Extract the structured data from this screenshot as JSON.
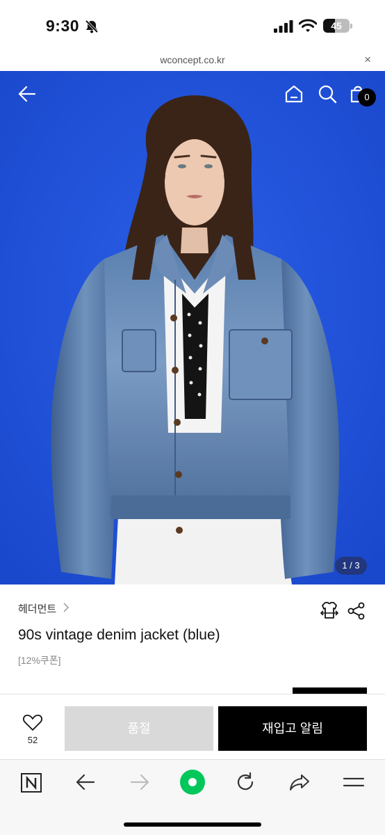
{
  "status_bar": {
    "time": "9:30",
    "battery_level": "45",
    "battery_percent": 45,
    "icons": [
      "bell-off-icon",
      "signal-icon",
      "wifi-icon",
      "battery-icon"
    ]
  },
  "browser": {
    "url": "wconcept.co.kr",
    "close_glyph": "×"
  },
  "hero": {
    "cart_count": "0",
    "image_counter": "1 / 3",
    "background_color": "#1d4fd6",
    "icons": [
      "back-arrow-icon",
      "home-icon",
      "search-icon",
      "shopping-bag-icon"
    ]
  },
  "product": {
    "brand": "헤더먼트",
    "title": "90s vintage denim jacket (blue)",
    "coupon": "[12%쿠폰]"
  },
  "actions": {
    "like_count": "52",
    "soldout_label": "품절",
    "restock_label": "재입고 알림"
  },
  "toolbar": {
    "icons": [
      "naver-n-icon",
      "back-icon",
      "forward-icon",
      "green-dot-icon",
      "refresh-icon",
      "share-icon",
      "menu-icon"
    ],
    "accent_color": "#03c75a"
  }
}
